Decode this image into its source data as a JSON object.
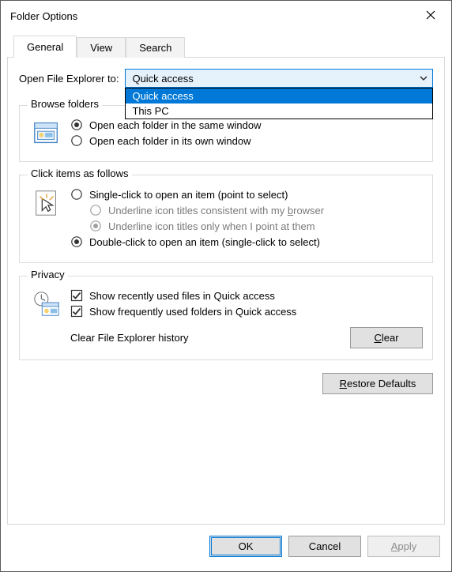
{
  "window": {
    "title": "Folder Options"
  },
  "tabs": {
    "general": "General",
    "view": "View",
    "search": "Search"
  },
  "open_to": {
    "label": "Open File Explorer to:",
    "selected": "Quick access",
    "options": [
      "Quick access",
      "This PC"
    ]
  },
  "browse": {
    "legend": "Browse folders",
    "same_window": "Open each folder in the same window",
    "own_window": "Open each folder in its own window"
  },
  "click_items": {
    "legend": "Click items as follows",
    "single": "Single-click to open an item (point to select)",
    "underline_browser_pre": "Underline icon titles consistent with my ",
    "underline_browser_u": "b",
    "underline_browser_post": "rowser",
    "underline_point": "Underline icon titles only when I point at them",
    "double": "Double-click to open an item (single-click to select)"
  },
  "privacy": {
    "legend": "Privacy",
    "recent_files": "Show recently used files in Quick access",
    "frequent_folders": "Show frequently used folders in Quick access",
    "clear_label": "Clear File Explorer history",
    "clear_btn_pre": "",
    "clear_btn_u": "C",
    "clear_btn_post": "lear"
  },
  "restore": {
    "pre": "",
    "u": "R",
    "post": "estore Defaults"
  },
  "buttons": {
    "ok": "OK",
    "cancel": "Cancel",
    "apply_u": "A",
    "apply_post": "pply"
  }
}
